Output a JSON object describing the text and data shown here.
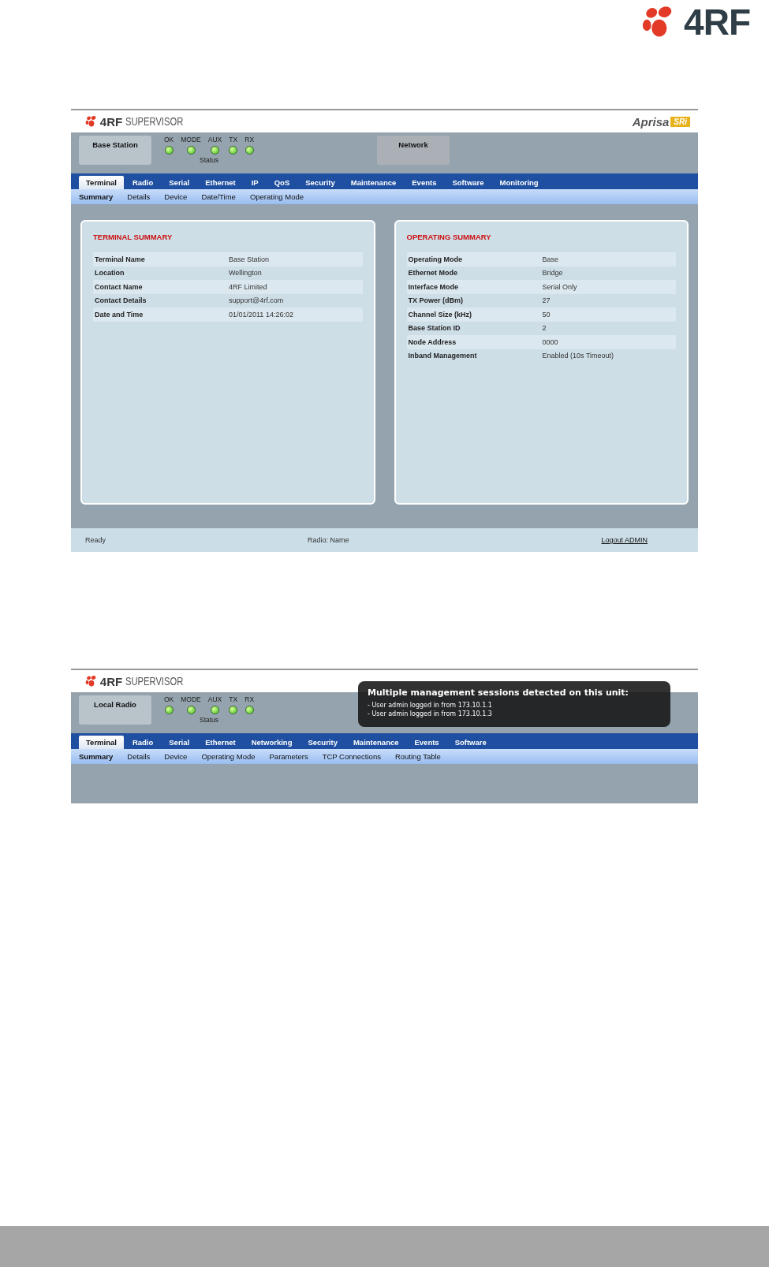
{
  "brand_logo": {
    "text": "4RF"
  },
  "screens": [
    {
      "header": {
        "logo": "4RF",
        "product": "SUPERVISOR",
        "brand": "Aprisa",
        "badge": "SRi"
      },
      "terminal_box": "Base Station",
      "leds": [
        {
          "label": "OK",
          "on": true
        },
        {
          "label": "MODE",
          "on": true
        },
        {
          "label": "AUX",
          "on": true
        },
        {
          "label": "TX",
          "on": true
        },
        {
          "label": "RX",
          "on": true
        }
      ],
      "status_label": "Status",
      "network_box": "Network",
      "tabs": [
        {
          "label": "Terminal",
          "selected": true
        },
        {
          "label": "Radio",
          "selected": false
        },
        {
          "label": "Serial",
          "selected": false
        },
        {
          "label": "Ethernet",
          "selected": false
        },
        {
          "label": "IP",
          "selected": false
        },
        {
          "label": "QoS",
          "selected": false
        },
        {
          "label": "Security",
          "selected": false
        },
        {
          "label": "Maintenance",
          "selected": false
        },
        {
          "label": "Events",
          "selected": false
        },
        {
          "label": "Software",
          "selected": false
        },
        {
          "label": "Monitoring",
          "selected": false
        }
      ],
      "subtabs": [
        {
          "label": "Summary",
          "selected": true
        },
        {
          "label": "Details",
          "selected": false
        },
        {
          "label": "Device",
          "selected": false
        },
        {
          "label": "Date/Time",
          "selected": false
        },
        {
          "label": "Operating Mode",
          "selected": false
        }
      ],
      "panels": [
        {
          "title": "TERMINAL SUMMARY",
          "rows": [
            [
              "Terminal Name",
              "Base Station"
            ],
            [
              "Location",
              "Wellington"
            ],
            [
              "Contact Name",
              "4RF Limited"
            ],
            [
              "Contact Details",
              "support@4rf.com"
            ],
            [
              "Date and Time",
              "01/01/2011 14:26:02"
            ]
          ]
        },
        {
          "title": "OPERATING SUMMARY",
          "rows": [
            [
              "Operating Mode",
              "Base"
            ],
            [
              "Ethernet Mode",
              "Bridge"
            ],
            [
              "Interface Mode",
              "Serial Only"
            ],
            [
              "TX Power (dBm)",
              "27"
            ],
            [
              "Channel Size (kHz)",
              "50"
            ],
            [
              "Base Station ID",
              "2"
            ],
            [
              "Node Address",
              "0000"
            ],
            [
              "Inband Management",
              "Enabled (10s Timeout)"
            ]
          ]
        }
      ],
      "status_bar": {
        "left": "Ready",
        "center": "Radio: Name",
        "link": "Logout ADMIN"
      }
    },
    {
      "header": {
        "logo": "4RF",
        "product": "SUPERVISOR"
      },
      "terminal_box": "Local Radio",
      "leds": [
        {
          "label": "OK",
          "on": true
        },
        {
          "label": "MODE",
          "on": true
        },
        {
          "label": "AUX",
          "on": true
        },
        {
          "label": "TX",
          "on": true
        },
        {
          "label": "RX",
          "on": true
        }
      ],
      "status_label": "Status",
      "tabs": [
        {
          "label": "Terminal",
          "selected": true
        },
        {
          "label": "Radio",
          "selected": false
        },
        {
          "label": "Serial",
          "selected": false
        },
        {
          "label": "Ethernet",
          "selected": false
        },
        {
          "label": "Networking",
          "selected": false
        },
        {
          "label": "Security",
          "selected": false
        },
        {
          "label": "Maintenance",
          "selected": false
        },
        {
          "label": "Events",
          "selected": false
        },
        {
          "label": "Software",
          "selected": false
        }
      ],
      "subtabs": [
        {
          "label": "Summary",
          "selected": true
        },
        {
          "label": "Details",
          "selected": false
        },
        {
          "label": "Device",
          "selected": false
        },
        {
          "label": "Operating Mode",
          "selected": false
        },
        {
          "label": "Parameters",
          "selected": false
        },
        {
          "label": "TCP Connections",
          "selected": false
        },
        {
          "label": "Routing Table",
          "selected": false
        }
      ],
      "popup": {
        "title": "Multiple management sessions detected on this unit:",
        "lines": [
          "-  User admin logged in from 173.10.1.1",
          "-  User admin logged in from 173.10.1.3"
        ]
      }
    }
  ]
}
